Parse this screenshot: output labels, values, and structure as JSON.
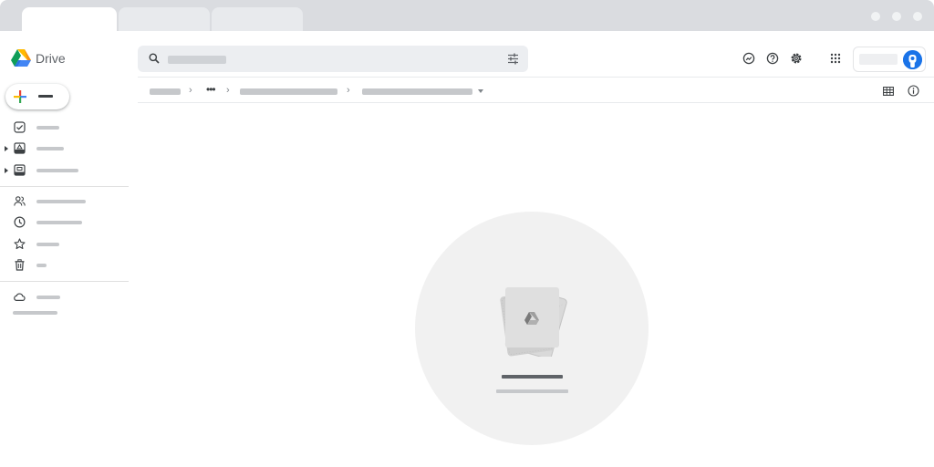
{
  "app": {
    "name": "Drive"
  },
  "colors": {
    "chrome_bg": "#dadce0",
    "search_bg": "#eceef1",
    "skeleton": "#c6c8cb",
    "accent_blue": "#1a73e8",
    "empty_circle": "#f1f1f1"
  },
  "icons": {
    "logo": "google-drive-logo-icon",
    "search": "search-icon",
    "filter": "tune-icon",
    "ready_offline": "ready-offline-icon",
    "help": "help-icon",
    "settings": "gear-icon",
    "apps": "apps-grid-icon",
    "new": "plus-icon",
    "nav_priority": "checkbox-icon",
    "nav_my_drive": "drive-folder-icon",
    "nav_computers": "computer-icon",
    "nav_shared": "people-icon",
    "nav_recent": "clock-icon",
    "nav_starred": "star-icon",
    "nav_trash": "trash-icon",
    "nav_storage": "cloud-icon",
    "crumb_more": "more-horiz-icon",
    "grid_view": "grid-view-icon",
    "info": "info-icon",
    "empty_state": "empty-folder-illustration"
  }
}
